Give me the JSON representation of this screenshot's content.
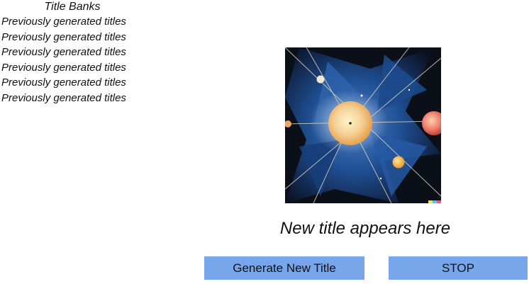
{
  "title_bank": {
    "heading": "Title Banks",
    "items": [
      "Previously generated titles",
      "Previously generated titles",
      "Previously generated titles",
      "Previously generated titles",
      "Previously generated titles",
      "Previously generated titles"
    ]
  },
  "main": {
    "new_title": "New title appears here",
    "image_icon": "cosmic-painting-image"
  },
  "buttons": {
    "generate_label": "Generate New Title",
    "stop_label": "STOP"
  },
  "colors": {
    "button_background": "#78a6ea"
  }
}
